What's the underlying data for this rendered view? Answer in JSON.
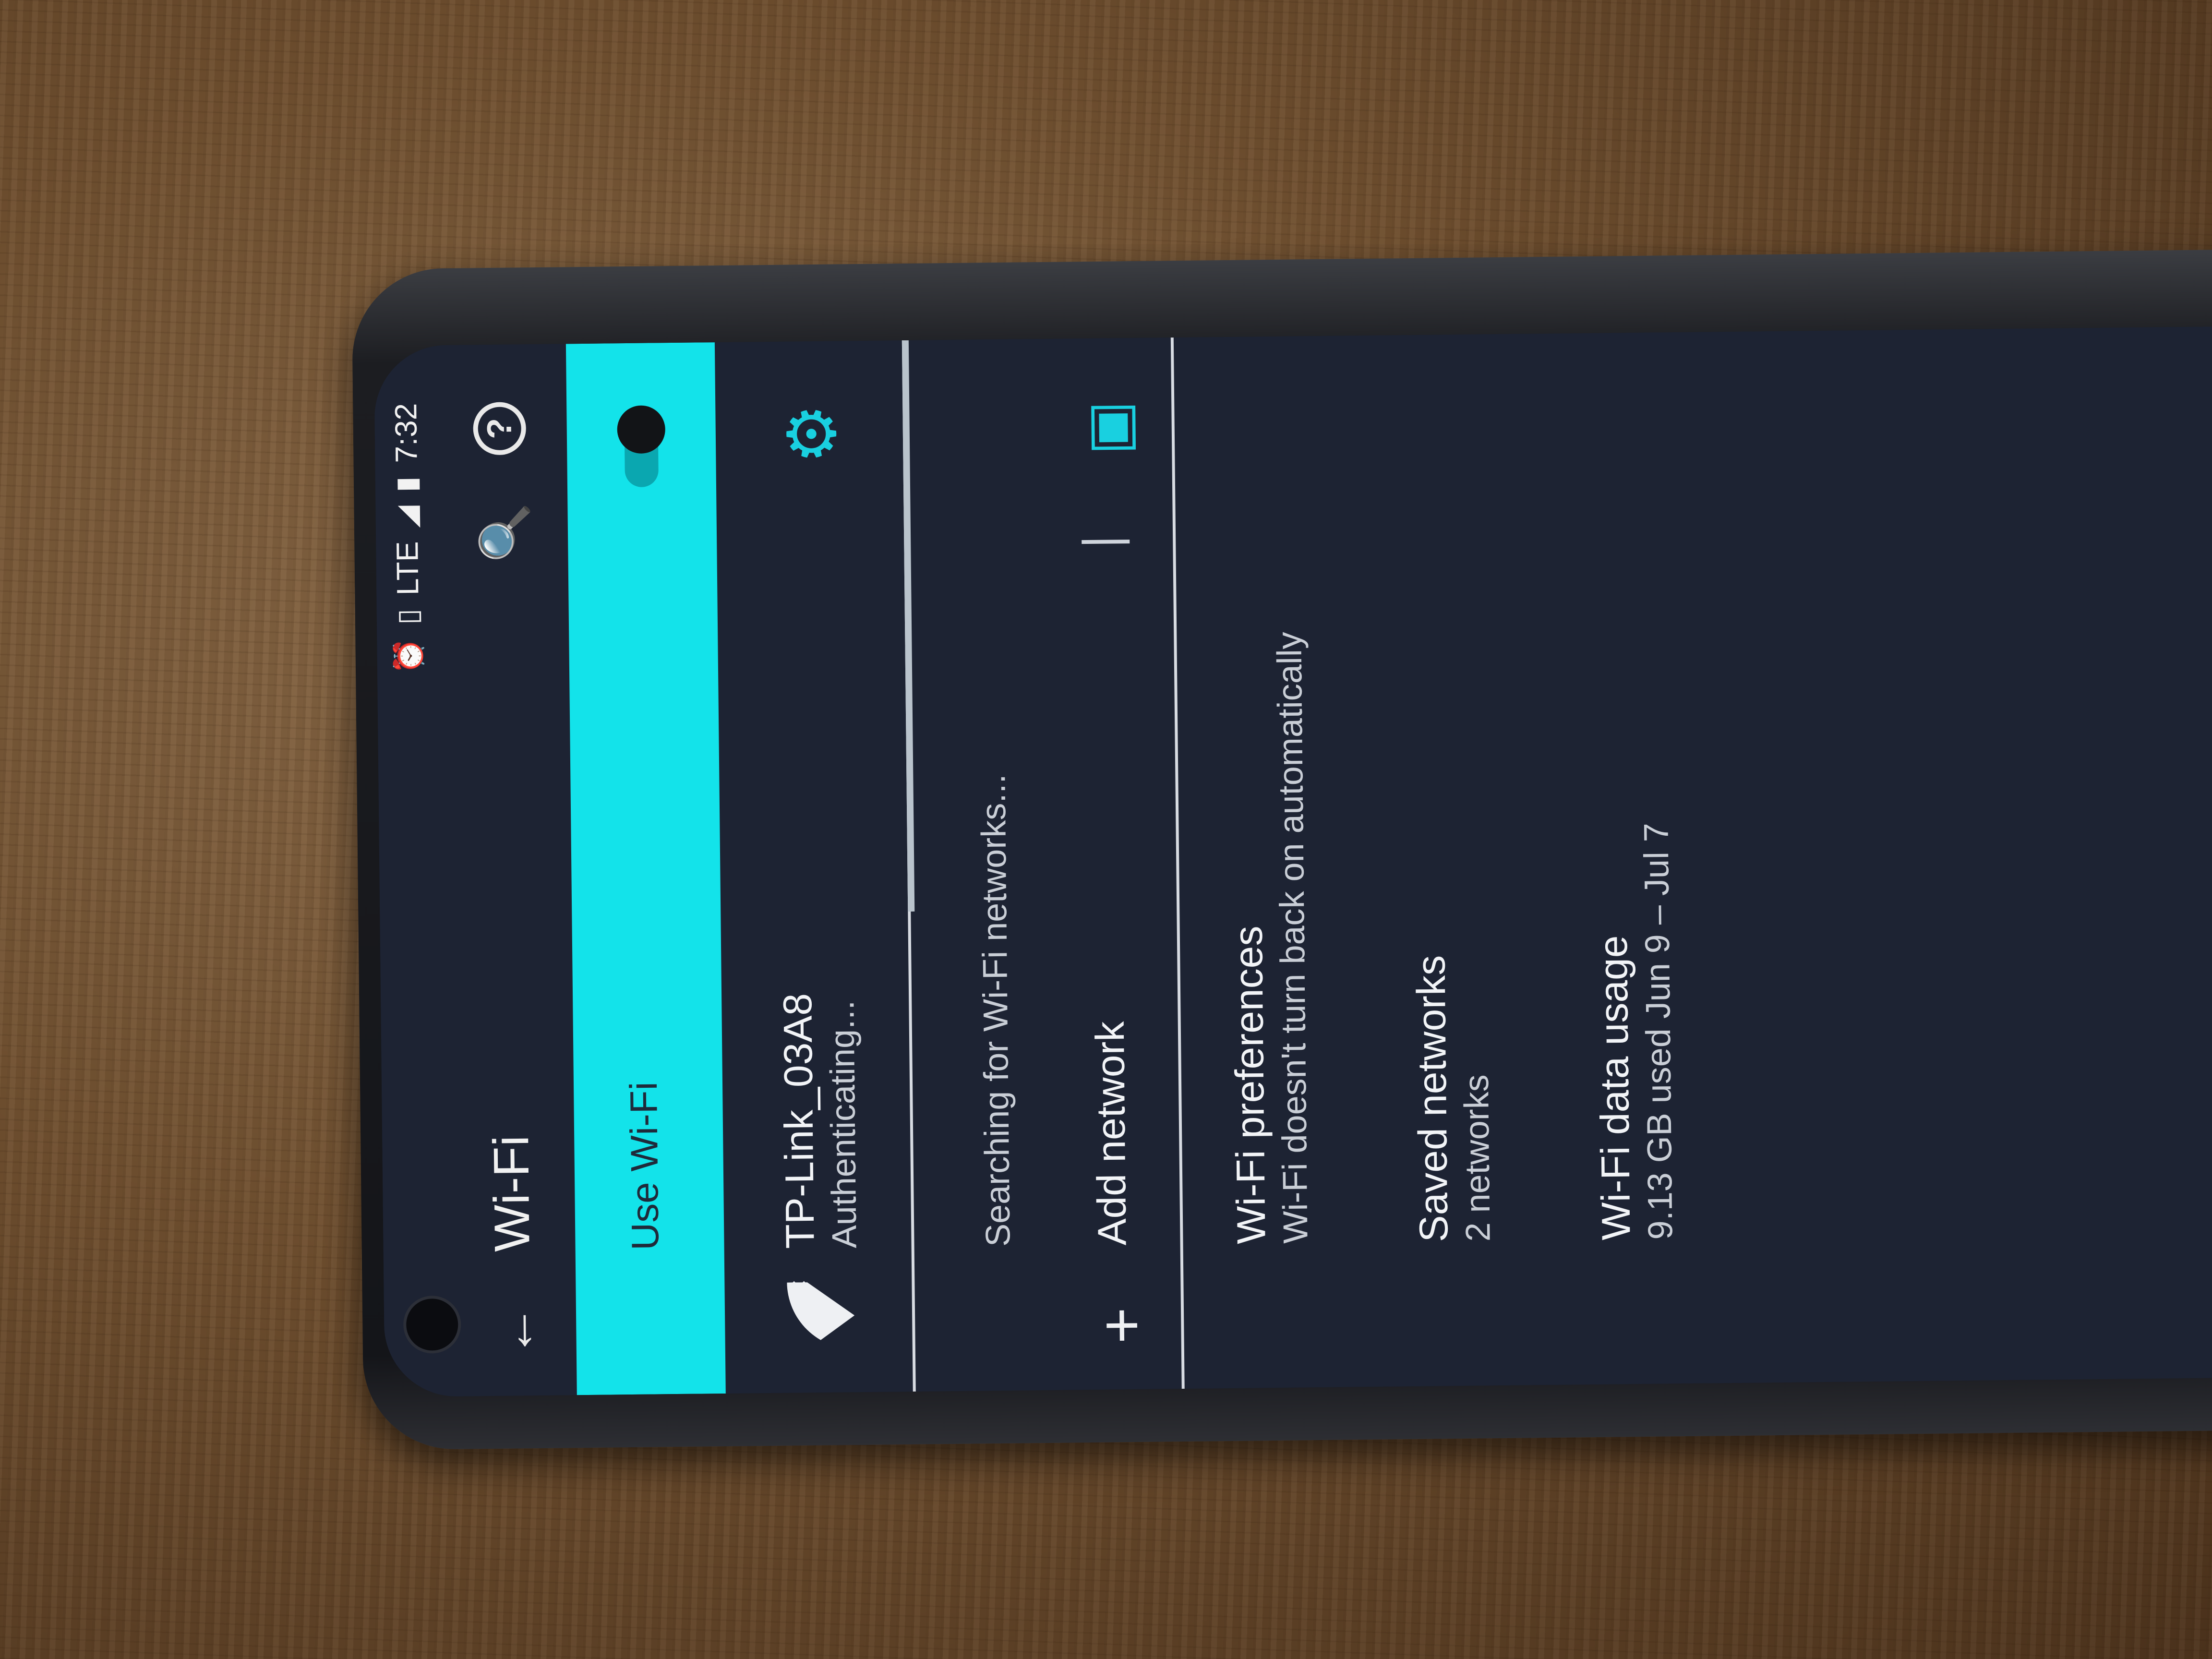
{
  "status_bar": {
    "time": "7:32",
    "network": "LTE",
    "icons": [
      "alarm-icon",
      "vibrate-icon",
      "signal-icon",
      "battery-icon"
    ]
  },
  "toolbar": {
    "title": "Wi-Fi",
    "back_icon": "arrow-back-icon",
    "search_icon": "search-icon",
    "help_icon": "help-icon"
  },
  "master_switch": {
    "label": "Use Wi-Fi",
    "state": "on",
    "accent": "#13e3ea"
  },
  "networks": [
    {
      "ssid": "TP-Link_03A8",
      "status": "Authenticating..."
    }
  ],
  "scan_status": "Searching for Wi-Fi networks...",
  "add_network": {
    "label": "Add network"
  },
  "preferences": [
    {
      "title": "Wi-Fi preferences",
      "summary": "Wi-Fi doesn't turn back on automatically"
    },
    {
      "title": "Saved networks",
      "summary": "2 networks"
    },
    {
      "title": "Wi-Fi data usage",
      "summary": "9.13 GB used Jun 9 – Jul 7"
    }
  ]
}
